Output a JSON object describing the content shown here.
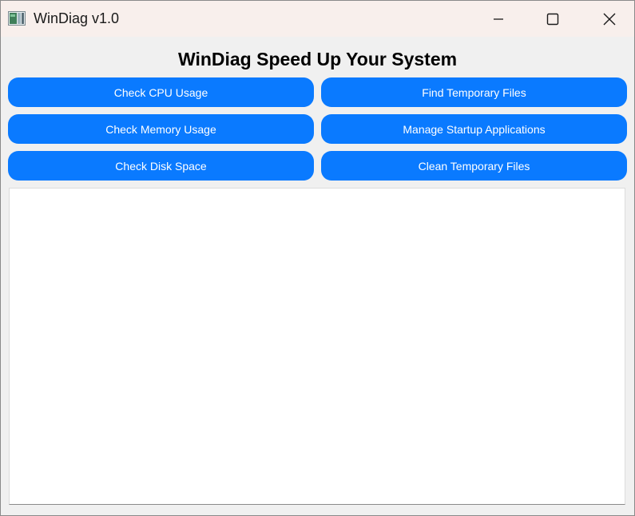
{
  "window": {
    "title": "WinDiag v1.0",
    "icon": "app-icon",
    "controls": {
      "minimize": "minimize-icon",
      "maximize": "maximize-icon",
      "close": "close-icon"
    }
  },
  "main": {
    "heading": "WinDiag Speed Up Your System",
    "buttons": {
      "check_cpu": "Check CPU Usage",
      "find_temp": "Find Temporary Files",
      "check_memory": "Check Memory Usage",
      "manage_startup": "Manage Startup Applications",
      "check_disk": "Check Disk Space",
      "clean_temp": "Clean Temporary Files"
    },
    "output_text": ""
  },
  "colors": {
    "accent": "#0a7aff",
    "titlebar": "#f8efec",
    "window_bg": "#f0f0f0"
  }
}
